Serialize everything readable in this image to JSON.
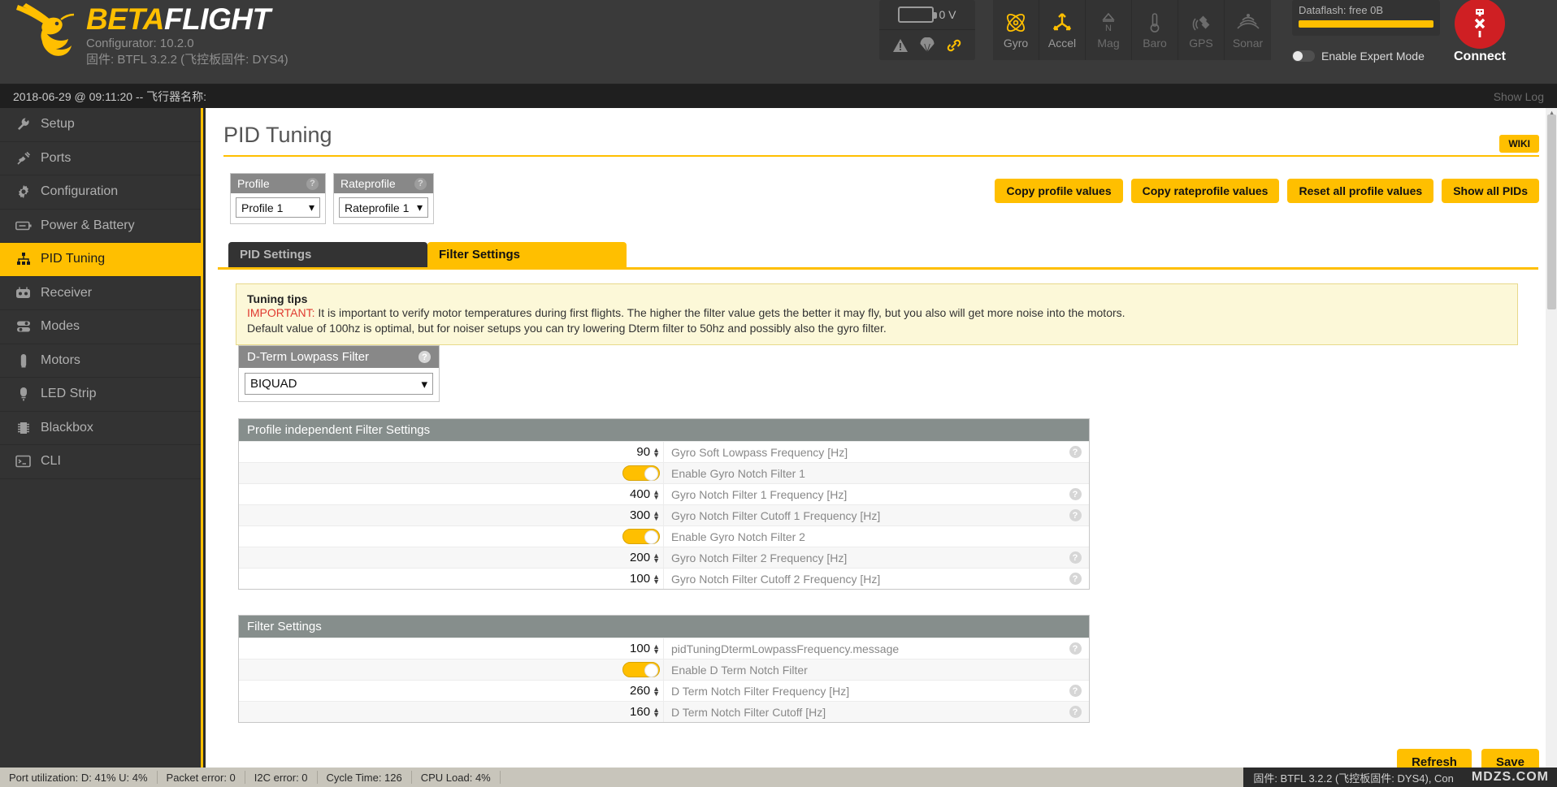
{
  "brand": {
    "name_part1": "BETA",
    "name_part2": "FLIGHT",
    "configurator": "Configurator: 10.2.0",
    "firmware": "固件: BTFL 3.2.2 (飞控板固件: DYS4)",
    "accent": "#ffbf00"
  },
  "header": {
    "battery_voltage": "0 V",
    "status_icons": [
      "warning-icon",
      "parachute-icon",
      "link-icon"
    ],
    "sensors": [
      {
        "label": "Gyro",
        "active": true
      },
      {
        "label": "Accel",
        "active": true
      },
      {
        "label": "Mag",
        "active": false
      },
      {
        "label": "Baro",
        "active": false
      },
      {
        "label": "GPS",
        "active": false
      },
      {
        "label": "Sonar",
        "active": false
      }
    ],
    "dataflash_label": "Dataflash: free 0B",
    "dataflash_percent": 100,
    "expert_mode_label": "Enable Expert Mode",
    "expert_mode_on": false,
    "connect_label": "Connect",
    "connect_color": "#cf1f23"
  },
  "infobar": {
    "session": "2018-06-29 @ 09:11:20 -- 飞行器名称:",
    "show_log": "Show Log"
  },
  "sidebar": {
    "items": [
      {
        "label": "Setup",
        "icon": "wrench-icon",
        "active": false
      },
      {
        "label": "Ports",
        "icon": "plug-icon",
        "active": false
      },
      {
        "label": "Configuration",
        "icon": "gear-icon",
        "active": false
      },
      {
        "label": "Power & Battery",
        "icon": "battery-icon",
        "active": false
      },
      {
        "label": "PID Tuning",
        "icon": "sitemap-icon",
        "active": true
      },
      {
        "label": "Receiver",
        "icon": "remote-icon",
        "active": false
      },
      {
        "label": "Modes",
        "icon": "sliders-icon",
        "active": false
      },
      {
        "label": "Motors",
        "icon": "motor-icon",
        "active": false
      },
      {
        "label": "LED Strip",
        "icon": "led-icon",
        "active": false
      },
      {
        "label": "Blackbox",
        "icon": "chip-icon",
        "active": false
      },
      {
        "label": "CLI",
        "icon": "terminal-icon",
        "active": false
      }
    ]
  },
  "main": {
    "page_title": "PID Tuning",
    "wiki_label": "WIKI",
    "profile": {
      "header": "Profile",
      "selected": "Profile 1"
    },
    "rateprofile": {
      "header": "Rateprofile",
      "selected": "Rateprofile 1"
    },
    "actions": [
      "Copy profile values",
      "Copy rateprofile values",
      "Reset all profile values",
      "Show all PIDs"
    ],
    "tabs": [
      {
        "label": "PID Settings",
        "active": false
      },
      {
        "label": "Filter Settings",
        "active": true
      }
    ],
    "tips": {
      "title": "Tuning tips",
      "important_prefix": "IMPORTANT:",
      "line1": " It is important to verify motor temperatures during first flights. The higher the filter value gets the better it may fly, but you also will get more noise into the motors.",
      "line2": "Default value of 100hz is optimal, but for noiser setups you can try lowering Dterm filter to 50hz and possibly also the gyro filter."
    },
    "dterm_lowpass": {
      "header": "D-Term Lowpass Filter",
      "selected": "BIQUAD"
    },
    "profile_independent": {
      "header": "Profile independent Filter Settings",
      "rows": [
        {
          "type": "number",
          "value": "90",
          "label": "Gyro Soft Lowpass Frequency [Hz]",
          "help": true
        },
        {
          "type": "toggle",
          "value": "on",
          "label": "Enable Gyro Notch Filter 1",
          "help": false
        },
        {
          "type": "number",
          "value": "400",
          "label": "Gyro Notch Filter 1 Frequency [Hz]",
          "help": true
        },
        {
          "type": "number",
          "value": "300",
          "label": "Gyro Notch Filter Cutoff 1 Frequency [Hz]",
          "help": true
        },
        {
          "type": "toggle",
          "value": "on",
          "label": "Enable Gyro Notch Filter 2",
          "help": false
        },
        {
          "type": "number",
          "value": "200",
          "label": "Gyro Notch Filter 2 Frequency [Hz]",
          "help": true
        },
        {
          "type": "number",
          "value": "100",
          "label": "Gyro Notch Filter Cutoff 2 Frequency [Hz]",
          "help": true
        }
      ]
    },
    "filter_settings": {
      "header": "Filter Settings",
      "rows": [
        {
          "type": "number",
          "value": "100",
          "label": "pidTuningDtermLowpassFrequency.message",
          "help": true
        },
        {
          "type": "toggle",
          "value": "on",
          "label": "Enable D Term Notch Filter",
          "help": false
        },
        {
          "type": "number",
          "value": "260",
          "label": "D Term Notch Filter Frequency [Hz]",
          "help": true
        },
        {
          "type": "number",
          "value": "160",
          "label": "D Term Notch Filter Cutoff [Hz]",
          "help": true
        }
      ]
    },
    "footer": {
      "refresh_label": "Refresh",
      "save_label": "Save"
    }
  },
  "statusbar": {
    "items": [
      "Port utilization: D: 41% U: 4%",
      "Packet error: 0",
      "I2C error: 0",
      "Cycle Time: 126",
      "CPU Load: 4%"
    ],
    "firmware_info": "固件: BTFL 3.2.2 (飞控板固件: DYS4), Con",
    "watermark": "MDZS.COM"
  }
}
